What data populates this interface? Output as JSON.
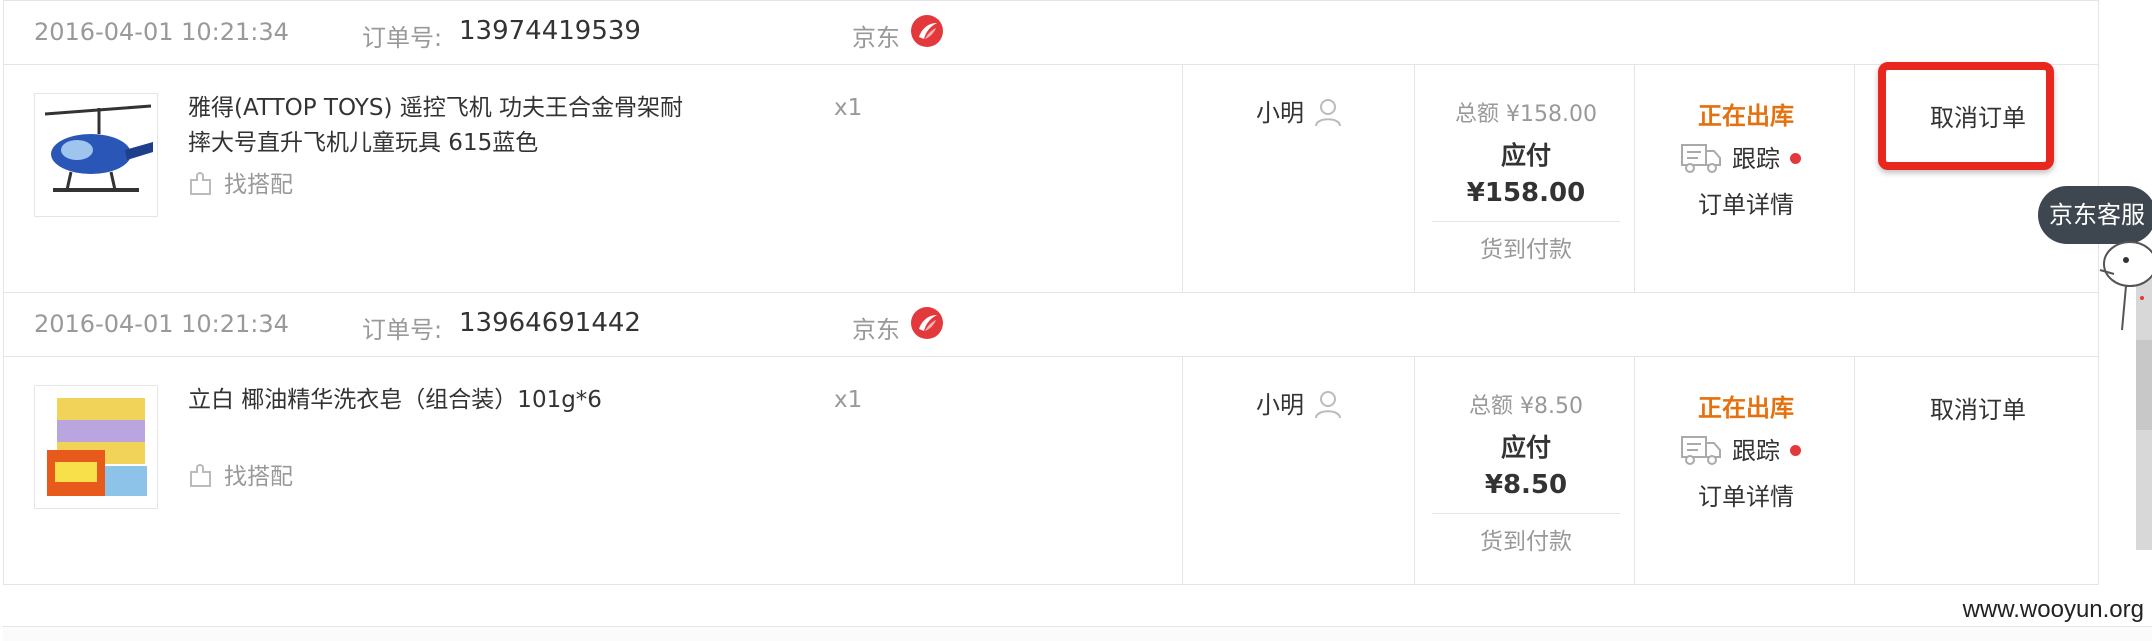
{
  "orders": [
    {
      "date": "2016-04-01 10:21:34",
      "order_label": "订单号:",
      "order_no": "13974419539",
      "shop": "京东",
      "product_name": "雅得(ATTOP TOYS) 遥控飞机 功夫王合金骨架耐摔大号直升飞机儿童玩具 615蓝色",
      "find_match": "找搭配",
      "qty": "x1",
      "recipient": "小明",
      "total": "总额 ¥158.00",
      "pay_label": "应付",
      "pay_amount": "¥158.00",
      "pay_method": "货到付款",
      "status": "正在出库",
      "track": "跟踪",
      "detail": "订单详情",
      "cancel": "取消订单"
    },
    {
      "date": "2016-04-01 10:21:34",
      "order_label": "订单号:",
      "order_no": "13964691442",
      "shop": "京东",
      "product_name": "立白 椰油精华洗衣皂（组合装）101g*6",
      "find_match": "找搭配",
      "qty": "x1",
      "recipient": "小明",
      "total": "总额 ¥8.50",
      "pay_label": "应付",
      "pay_amount": "¥8.50",
      "pay_method": "货到付款",
      "status": "正在出库",
      "track": "跟踪",
      "detail": "订单详情",
      "cancel": "取消订单"
    }
  ],
  "customer_service": "京东客服",
  "watermark": "www.wooyun.org",
  "colors": {
    "status_orange": "#e4700e",
    "highlight_red": "#e8281e",
    "dot_red": "#e4393c",
    "muted_gray": "#999999"
  }
}
